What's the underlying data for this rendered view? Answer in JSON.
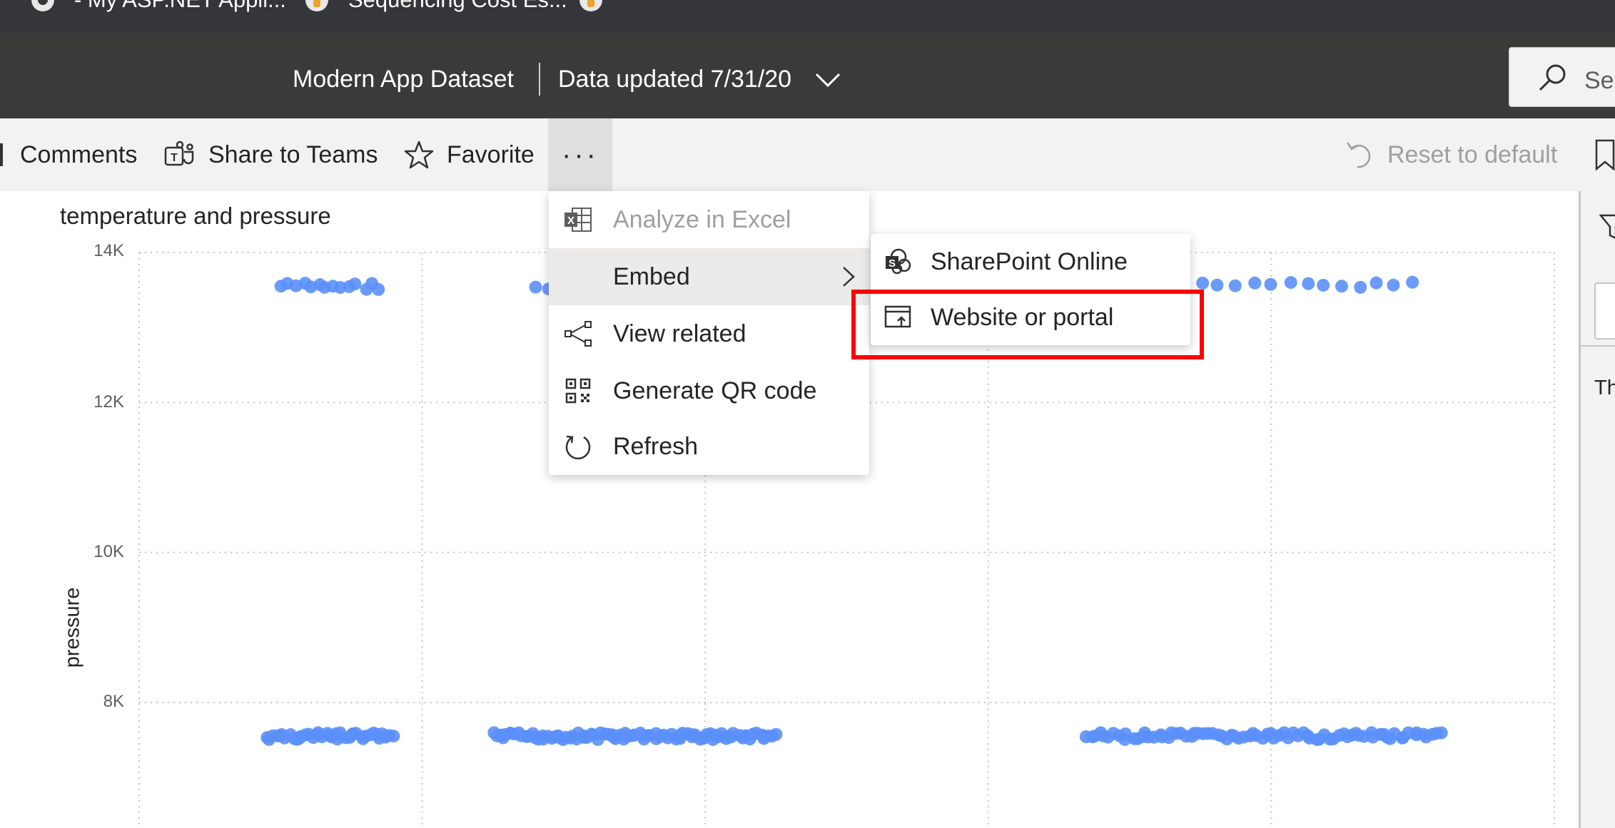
{
  "browser_tabs": [
    {
      "label": "- My ASP.NET Appli..."
    },
    {
      "label": "Sequencing Cost Es..."
    }
  ],
  "header": {
    "dataset_name": "Modern App Dataset",
    "data_updated": "Data updated 7/31/20",
    "search_placeholder": "Sea"
  },
  "actions": {
    "comments": "Comments",
    "share_to_teams": "Share to Teams",
    "favorite": "Favorite",
    "more": "···",
    "reset": "Reset to default"
  },
  "more_menu": {
    "items": [
      {
        "label": "Analyze in Excel",
        "icon": "excel-icon",
        "disabled": true
      },
      {
        "label": "Embed",
        "icon": "none",
        "has_submenu": true
      },
      {
        "label": "View related",
        "icon": "share-nodes-icon"
      },
      {
        "label": "Generate QR code",
        "icon": "qr-code-icon"
      },
      {
        "label": "Refresh",
        "icon": "refresh-icon"
      }
    ]
  },
  "embed_submenu": {
    "items": [
      {
        "label": "SharePoint Online",
        "icon": "sharepoint-icon"
      },
      {
        "label": "Website or portal",
        "icon": "website-icon",
        "highlighted": true
      }
    ]
  },
  "right_pane": {
    "partial_text": "Th"
  },
  "colors": {
    "header_bg": "#3b3a39",
    "accent_point": "#5b8ff9",
    "highlight": "#ff0000"
  },
  "chart_data": {
    "type": "scatter",
    "title": "temperature and pressure",
    "xlabel": "",
    "ylabel": "pressure",
    "ylim": [
      6500,
      14000
    ],
    "yticks": [
      "14K",
      "12K",
      "10K",
      "8K"
    ],
    "grid": true,
    "clusters": [
      {
        "y": 13550,
        "x_from": 0.1,
        "x_to": 0.17,
        "count": 14
      },
      {
        "y": 13530,
        "x_from": 0.28,
        "x_to": 0.29,
        "count": 2
      },
      {
        "y": 13560,
        "x_from": 0.75,
        "x_to": 0.9,
        "count": 13
      },
      {
        "y": 7550,
        "x_from": 0.09,
        "x_to": 0.18,
        "count": 40
      },
      {
        "y": 7550,
        "x_from": 0.25,
        "x_to": 0.45,
        "count": 90
      },
      {
        "y": 7550,
        "x_from": 0.67,
        "x_to": 0.92,
        "count": 80
      }
    ]
  }
}
